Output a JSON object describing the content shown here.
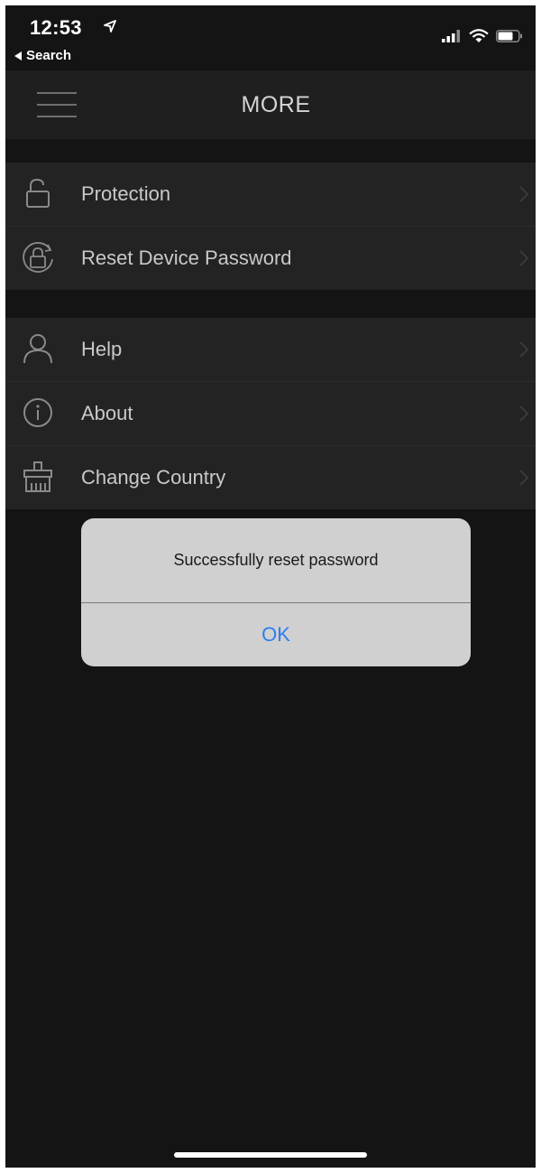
{
  "status_bar": {
    "time": "12:53",
    "back_label": "Search",
    "location_icon": "location-arrow-icon",
    "signal_icon": "cellular-signal-icon",
    "wifi_icon": "wifi-icon",
    "battery_icon": "battery-icon"
  },
  "navbar": {
    "title": "MORE",
    "menu_icon": "hamburger-menu-icon"
  },
  "sections": [
    {
      "items": [
        {
          "label": "Protection",
          "icon": "lock-icon"
        },
        {
          "label": "Reset Device Password",
          "icon": "lock-reset-icon"
        }
      ]
    },
    {
      "items": [
        {
          "label": "Help",
          "icon": "person-icon"
        },
        {
          "label": "About",
          "icon": "info-icon"
        },
        {
          "label": "Change Country",
          "icon": "broom-icon"
        }
      ]
    }
  ],
  "alert": {
    "message": "Successfully reset password",
    "ok_label": "OK"
  },
  "colors": {
    "background": "#141414",
    "row_background": "#232323",
    "alert_background": "#d0d0d0",
    "accent": "#2f7ef0"
  }
}
